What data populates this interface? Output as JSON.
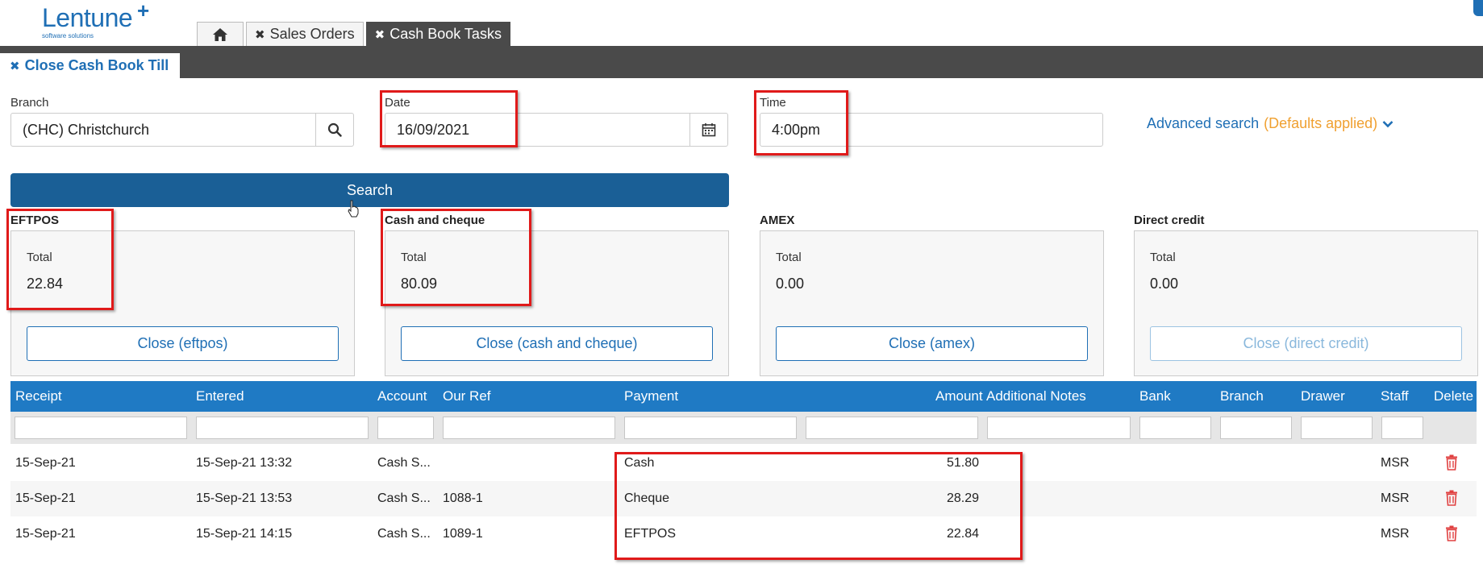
{
  "header": {
    "logo_text": "Lentune",
    "logo_sub": "software solutions",
    "tabs": [
      {
        "label": "Sales Orders"
      },
      {
        "label": "Cash Book Tasks"
      }
    ],
    "sub_tab": "Close Cash Book Till"
  },
  "form": {
    "branch_label": "Branch",
    "branch_value": "(CHC) Christchurch",
    "date_label": "Date",
    "date_value": "16/09/2021",
    "time_label": "Time",
    "time_value": "4:00pm",
    "advanced_search": "Advanced search",
    "defaults_applied": "(Defaults applied)",
    "search_button": "Search"
  },
  "panels": [
    {
      "title": "EFTPOS",
      "total_label": "Total",
      "total": "22.84",
      "button": "Close (eftpos)"
    },
    {
      "title": "Cash and cheque",
      "total_label": "Total",
      "total": "80.09",
      "button": "Close (cash and cheque)"
    },
    {
      "title": "AMEX",
      "total_label": "Total",
      "total": "0.00",
      "button": "Close (amex)"
    },
    {
      "title": "Direct credit",
      "total_label": "Total",
      "total": "0.00",
      "button": "Close (direct credit)"
    }
  ],
  "table": {
    "columns": [
      "Receipt",
      "Entered",
      "Account",
      "Our Ref",
      "Payment",
      "Amount",
      "Additional Notes",
      "Bank",
      "Branch",
      "Drawer",
      "Staff",
      "Delete"
    ],
    "rows": [
      {
        "receipt": "15-Sep-21",
        "entered": "15-Sep-21 13:32",
        "account": "Cash S...",
        "our_ref": "",
        "payment": "Cash",
        "amount": "51.80",
        "staff": "MSR"
      },
      {
        "receipt": "15-Sep-21",
        "entered": "15-Sep-21 13:53",
        "account": "Cash S...",
        "our_ref": "1088-1",
        "payment": "Cheque",
        "amount": "28.29",
        "staff": "MSR"
      },
      {
        "receipt": "15-Sep-21",
        "entered": "15-Sep-21 14:15",
        "account": "Cash S...",
        "our_ref": "1089-1",
        "payment": "EFTPOS",
        "amount": "22.84",
        "staff": "MSR"
      }
    ]
  },
  "colors": {
    "brand_blue": "#1f6fb5",
    "header_dark": "#4a4a4a",
    "table_header": "#1f7ac4",
    "search_button": "#1a5f96",
    "annotation_red": "#e01a1a",
    "defaults_orange": "#f0a030",
    "delete_red": "#e04040"
  }
}
